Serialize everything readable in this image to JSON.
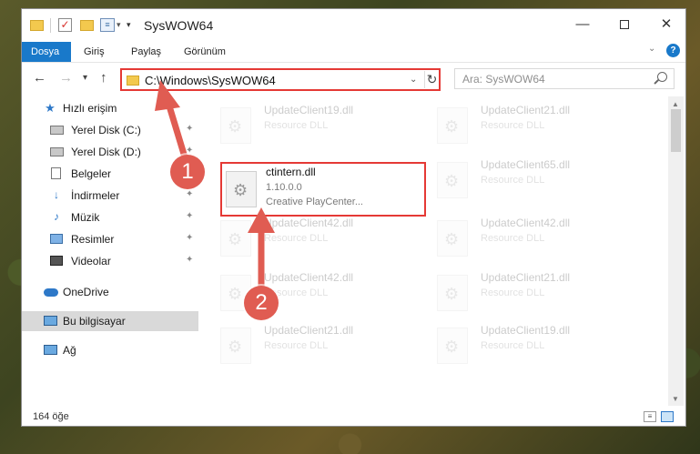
{
  "window": {
    "title": "SysWOW64",
    "controls": {
      "minimize": "—",
      "close": "✕"
    }
  },
  "ribbon": {
    "tabs": [
      "Dosya",
      "Giriş",
      "Paylaş",
      "Görünüm"
    ],
    "help": "?"
  },
  "nav": {
    "address": "C:\\Windows\\SysWOW64",
    "search_placeholder": "Ara: SysWOW64"
  },
  "sidebar": {
    "items": [
      {
        "label": "Hızlı erişim",
        "icon": "star-icon"
      },
      {
        "label": "Yerel Disk (C:)",
        "icon": "drive-icon",
        "pinned": true
      },
      {
        "label": "Yerel Disk (D:)",
        "icon": "drive-icon",
        "pinned": true
      },
      {
        "label": "Belgeler",
        "icon": "document-icon",
        "pinned": true
      },
      {
        "label": "İndirmeler",
        "icon": "download-icon",
        "pinned": true
      },
      {
        "label": "Müzik",
        "icon": "music-icon",
        "pinned": true
      },
      {
        "label": "Resimler",
        "icon": "pictures-icon",
        "pinned": true
      },
      {
        "label": "Videolar",
        "icon": "video-icon",
        "pinned": true
      },
      {
        "label": "OneDrive",
        "icon": "cloud-icon"
      },
      {
        "label": "Bu bilgisayar",
        "icon": "computer-icon",
        "selected": true
      },
      {
        "label": "Ağ",
        "icon": "network-icon"
      }
    ]
  },
  "files": [
    {
      "name": "UpdateClient19.dll",
      "desc": "Resource DLL",
      "faded": true
    },
    {
      "name": "UpdateClient21.dll",
      "desc": "Resource DLL",
      "faded": true
    },
    {
      "name": "ctintern.dll",
      "version": "1.10.0.0",
      "company": "Creative PlayCenter...",
      "highlighted": true
    },
    {
      "name": "UpdateClient65.dll",
      "desc": "Resource DLL",
      "faded": true
    },
    {
      "name": "UpdateClient42.dll",
      "desc": "Resource DLL",
      "faded": true
    },
    {
      "name": "UpdateClient42.dll",
      "desc": "Resource DLL",
      "faded": true
    },
    {
      "name": "UpdateClient42.dll",
      "desc": "Resource DLL",
      "faded": true
    },
    {
      "name": "UpdateClient21.dll",
      "desc": "Resource DLL",
      "faded": true
    },
    {
      "name": "UpdateClient21.dll",
      "desc": "Resource DLL",
      "faded": true
    },
    {
      "name": "UpdateClient19.dll",
      "desc": "Resource DLL",
      "faded": true
    }
  ],
  "status": {
    "count": "164 öğe"
  },
  "annotations": [
    {
      "label": "1"
    },
    {
      "label": "2"
    }
  ],
  "colors": {
    "accent": "#1979ca",
    "highlight": "#e53935",
    "annotation": "#e05c52"
  }
}
